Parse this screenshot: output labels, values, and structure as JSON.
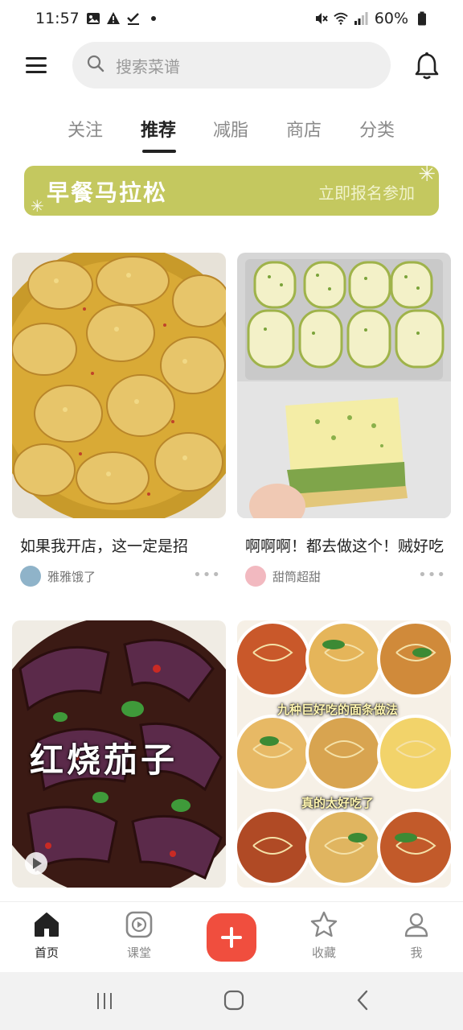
{
  "status_bar": {
    "time": "11:57",
    "battery": "60%",
    "left_icons": [
      "image-icon",
      "warning-icon",
      "check-icon",
      "dot-icon"
    ],
    "right_icons": [
      "mute-icon",
      "wifi-icon",
      "signal-icon",
      "battery-icon"
    ]
  },
  "header": {
    "search_placeholder": "搜索菜谱"
  },
  "tabs": [
    {
      "label": "关注",
      "active": false
    },
    {
      "label": "推荐",
      "active": true
    },
    {
      "label": "减脂",
      "active": false
    },
    {
      "label": "商店",
      "active": false
    },
    {
      "label": "分类",
      "active": false
    }
  ],
  "banner": {
    "title": "早餐马拉松",
    "cta": "立即报名参加",
    "color": "#c4c85f"
  },
  "feed": [
    {
      "title": "如果我开店，这一定是招",
      "author": "雅雅饿了",
      "image": "osmanthus-jelly-dessert"
    },
    {
      "title": "啊啊啊！都去做这个！贼好吃",
      "author": "甜筒超甜",
      "image": "matcha-cheesecake-bars"
    },
    {
      "title": "",
      "author": "",
      "image": "braised-eggplant",
      "overlay": "红烧茄子",
      "is_video": true
    },
    {
      "title": "",
      "author": "",
      "image": "noodle-bowls-grid",
      "overlay_top": "九种巨好吃的面条做法",
      "overlay_bottom": "真的太好吃了"
    }
  ],
  "bottom_nav": [
    {
      "label": "首页",
      "icon": "home-icon",
      "active": true
    },
    {
      "label": "课堂",
      "icon": "play-icon",
      "active": false
    },
    {
      "label": "",
      "icon": "add-icon",
      "active": false
    },
    {
      "label": "收藏",
      "icon": "star-icon",
      "active": false
    },
    {
      "label": "我",
      "icon": "user-icon",
      "active": false
    }
  ],
  "colors": {
    "accent": "#f04e3e",
    "banner": "#c4c85f"
  }
}
